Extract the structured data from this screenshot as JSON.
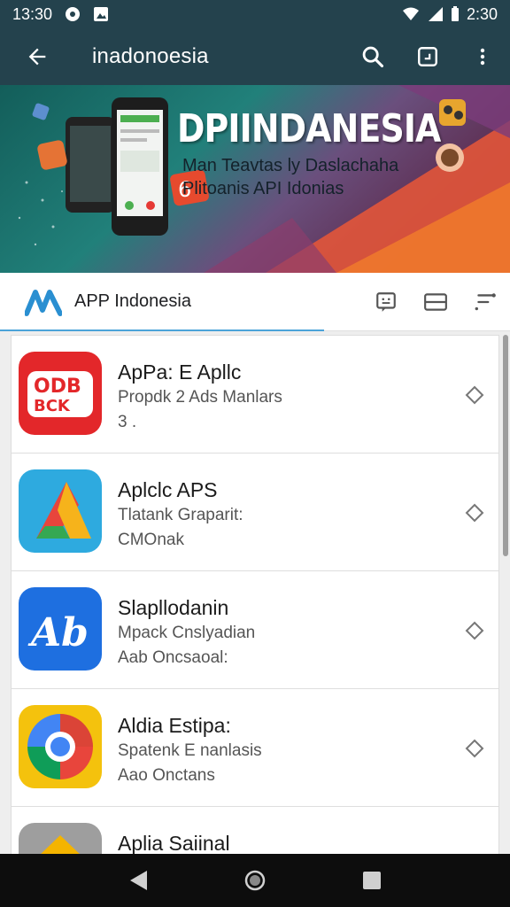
{
  "status_bar": {
    "time_left": "13:30",
    "time_right": "2:30",
    "icons_left": [
      "circle-app-icon",
      "photo-icon"
    ],
    "icons_right": [
      "wifi-icon",
      "signal-icon",
      "battery-icon"
    ]
  },
  "app_bar": {
    "title": "inadonoesia",
    "icons": [
      "back-arrow-icon",
      "search-icon",
      "square-icon",
      "overflow-menu-icon"
    ]
  },
  "banner": {
    "title": "DPIINDANESIA",
    "subtitle_line1": "Man Teavtas ly Daslachaha",
    "subtitle_line2": "Plitoanis API Idonias"
  },
  "tab": {
    "label": "APP Indonesia",
    "accent": "#4ba3d9",
    "icons": [
      "feedback-icon",
      "card-icon",
      "sort-icon"
    ]
  },
  "apps": [
    {
      "name": "ApPa: E Apllc",
      "line1": "Propdk 2 Ads Manlars",
      "line2": "3 .",
      "icon": "odbck-logo"
    },
    {
      "name": "Aplclc APS",
      "line1": "Tlatank Graparit:",
      "line2": "CMOnak",
      "icon": "triangle-logo"
    },
    {
      "name": "Slapllodanin",
      "line1": "Mpack Cnslyadian",
      "line2": "Aab Oncsaoal:",
      "icon": "ab-logo"
    },
    {
      "name": "Aldia Estipa:",
      "line1": "Spatenk E nanlasis",
      "line2": "Aao Onctans",
      "icon": "ring-logo"
    },
    {
      "name": "Aplia Saiinal",
      "line1": "",
      "line2": "",
      "icon": "folder-logo"
    }
  ],
  "nav_bar": {
    "icons": [
      "back-triangle-icon",
      "home-circle-icon",
      "recents-square-icon"
    ]
  },
  "colors": {
    "app_bar": "#24424d",
    "nav_bar": "#0d0d0d",
    "list_background": "#eeeeee"
  }
}
